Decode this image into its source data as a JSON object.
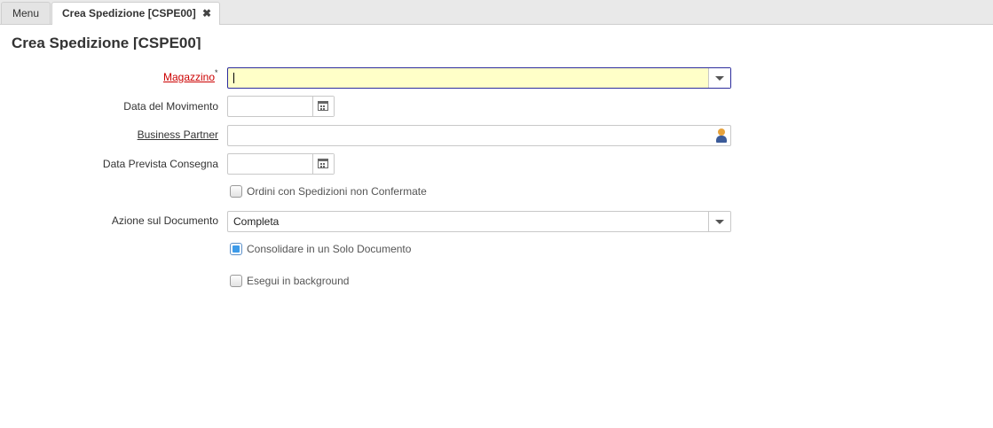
{
  "tabs": {
    "menu_label": "Menu",
    "active_label": "Crea Spedizione [CSPE00]",
    "close_glyph": "✖"
  },
  "page": {
    "title": "Crea Spedizione [CSPE00]"
  },
  "form": {
    "magazzino": {
      "label": "Magazzino",
      "required_mark": "*",
      "value": ""
    },
    "data_movimento": {
      "label": "Data del Movimento",
      "value": ""
    },
    "business_partner": {
      "label": "Business Partner",
      "value": ""
    },
    "data_prevista": {
      "label": "Data Prevista Consegna",
      "value": ""
    },
    "ordini_non_confermati": {
      "label": "Ordini con Spedizioni non Confermate",
      "checked": false
    },
    "azione_documento": {
      "label": "Azione sul Documento",
      "value": "Completa"
    },
    "consolidare": {
      "label": "Consolidare in un Solo Documento",
      "checked": true
    },
    "background": {
      "label": "Esegui in background",
      "checked": false
    }
  },
  "colors": {
    "required_label": "#cc0000",
    "focus_border": "#2c2c9c",
    "focus_background": "#ffffc8",
    "checkbox_checked": "#3d9be9"
  },
  "icons": [
    "close-icon",
    "dropdown-arrow-icon",
    "calendar-icon",
    "business-partner-icon"
  ]
}
